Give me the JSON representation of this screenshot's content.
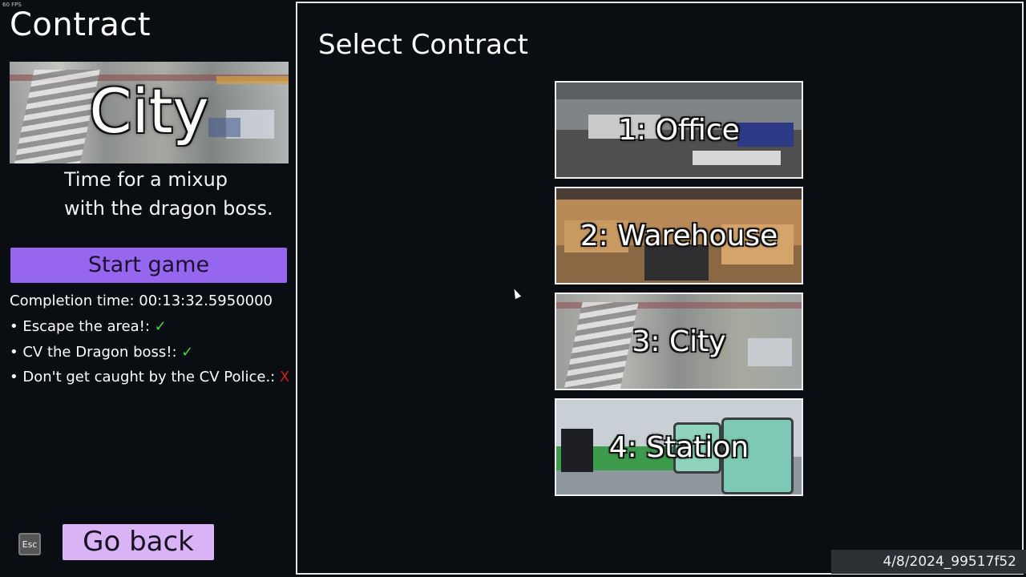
{
  "fps": "60 FPS",
  "left_panel": {
    "title": "Contract",
    "preview_label": "City",
    "description": "Time for a mixup\nwith the dragon boss.",
    "start_label": "Start game",
    "completion_time": "Completion time: 00:13:32.5950000",
    "objectives": [
      {
        "text": "• Escape the area!:",
        "mark": "✓",
        "status": "done"
      },
      {
        "text": "• CV the Dragon boss!:",
        "mark": "✓",
        "status": "done"
      },
      {
        "text": "• Don't get caught by the CV Police.:",
        "mark": "X",
        "status": "failed"
      }
    ],
    "esc_label": "Esc",
    "back_label": "Go back"
  },
  "right_panel": {
    "title": "Select Contract",
    "contracts": [
      {
        "label": "1: Office"
      },
      {
        "label": "2: Warehouse"
      },
      {
        "label": "3: City"
      },
      {
        "label": "4: Station"
      }
    ]
  },
  "build_id": "4/8/2024_99517f52",
  "colors": {
    "start_button": "#9666ee",
    "back_button": "#d9b3f5",
    "success": "#3fdc3f",
    "fail": "#d11a1a"
  }
}
